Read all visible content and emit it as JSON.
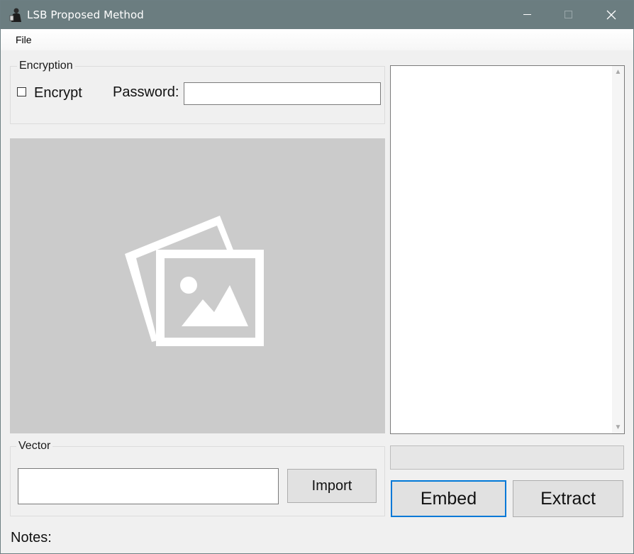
{
  "window": {
    "title": "LSB Proposed Method",
    "titlebar_color": "#6b7d80"
  },
  "menu": {
    "file_label": "File"
  },
  "encryption": {
    "legend": "Encryption",
    "encrypt_label": "Encrypt",
    "encrypt_checked": false,
    "password_label": "Password:",
    "password_value": ""
  },
  "image_panel": {
    "placeholder_icon": "image-placeholder-icon",
    "background": "#cbcbcb"
  },
  "output_text": {
    "value": ""
  },
  "vector": {
    "legend": "Vector",
    "input_value": "",
    "import_label": "Import"
  },
  "progress": {
    "value": 0
  },
  "actions": {
    "embed_label": "Embed",
    "extract_label": "Extract",
    "focus_color": "#0078d7"
  },
  "notes": {
    "label": "Notes:"
  }
}
